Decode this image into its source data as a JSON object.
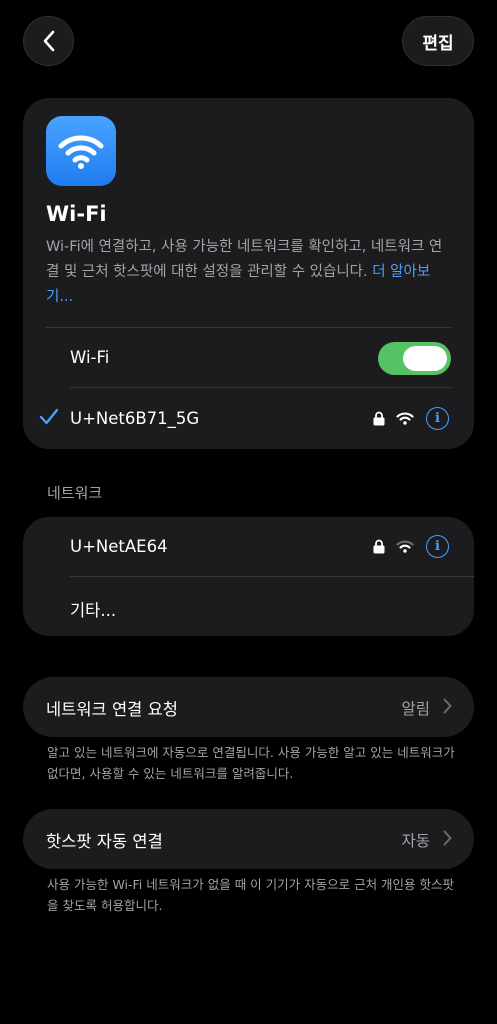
{
  "header": {
    "edit_label": "편집"
  },
  "wifi_card": {
    "title": "Wi-Fi",
    "description": "Wi-Fi에 연결하고, 사용 가능한 네트워크를 확인하고, 네트워크 연결 및 근처 핫스팟에 대한 설정을 관리할 수 있습니다.",
    "learn_more": "더 알아보기...",
    "toggle_label": "Wi-Fi",
    "toggle_on": true,
    "connected_network": "U+Net6B71_5G"
  },
  "networks": {
    "section_label": "네트워크",
    "items": [
      {
        "name": "U+NetAE64"
      },
      {
        "name": "기타..."
      }
    ]
  },
  "ask_to_join": {
    "label": "네트워크 연결 요청",
    "value": "알림",
    "footer": "알고 있는 네트워크에 자동으로 연결됩니다. 사용 가능한 알고 있는 네트워크가 없다면, 사용할 수 있는 네트워크를 알려줍니다."
  },
  "auto_hotspot": {
    "label": "핫스팟 자동 연결",
    "value": "자동",
    "footer": "사용 가능한 Wi-Fi 네트워크가 없을 때 이 기기가 자동으로 근처 개인용 핫스팟을 찾도록 허용합니다."
  },
  "colors": {
    "accent": "#4a9fff",
    "toggle_on": "#55c264",
    "card": "#1c1c1e",
    "background": "#000000"
  },
  "icons": {
    "back": "chevron-left-icon",
    "app": "wifi-icon",
    "lock": "lock-icon",
    "signal": "wifi-icon",
    "info": "info-icon",
    "check": "checkmark-icon",
    "chevron": "chevron-right-icon"
  }
}
